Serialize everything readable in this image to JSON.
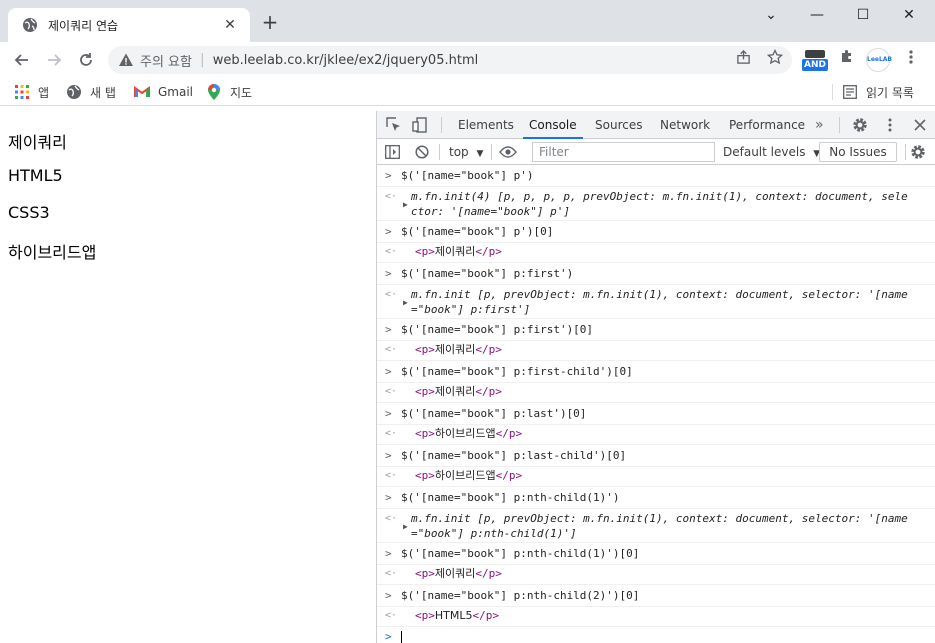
{
  "browser": {
    "tab_title": "제이쿼리 연습",
    "tab_close": "✕",
    "new_tab": "+",
    "window_controls": {
      "minimize": "⌄",
      "restore": "—",
      "maximize": "☐",
      "close": "✕"
    }
  },
  "address_bar": {
    "security_label": "주의 요함",
    "url": "web.leelab.co.kr/jklee/ex2/jquery05.html",
    "extension_badge": "AND",
    "profile_label": "LeeLAB"
  },
  "bookmarks": {
    "items": [
      {
        "label": "앱",
        "icon": "apps-grid-icon"
      },
      {
        "label": "새 탭",
        "icon": "globe-icon"
      },
      {
        "label": "Gmail",
        "icon": "gmail-icon"
      },
      {
        "label": "지도",
        "icon": "maps-icon"
      }
    ],
    "reading_list": "읽기 목록"
  },
  "page": {
    "paragraphs": [
      "제이쿼리",
      "HTML5",
      "CSS3",
      "하이브리드앱"
    ]
  },
  "devtools": {
    "tabs": [
      "Elements",
      "Console",
      "Sources",
      "Network",
      "Performance"
    ],
    "active_tab": "Console",
    "more_tabs": "»",
    "context": "top",
    "filter_placeholder": "Filter",
    "levels": "Default levels",
    "issues": "No Issues",
    "console": {
      "in1": "$('[name=\"book\"] p')",
      "out1_line1": "m.fn.init(4) [p, p, p, p, prevObject: m.fn.init(1), context: document, sele",
      "out1_line2": "ctor: '[name=\"book\"] p']",
      "in2": "$('[name=\"book\"] p')[0]",
      "out2": "제이쿼리",
      "in3": "$('[name=\"book\"] p:first')",
      "out3_line1": "m.fn.init [p, prevObject: m.fn.init(1), context: document, selector: '[name",
      "out3_line2": "=\"book\"] p:first']",
      "in4": "$('[name=\"book\"] p:first')[0]",
      "out4": "제이쿼리",
      "in5": "$('[name=\"book\"] p:first-child')[0]",
      "out5": "제이쿼리",
      "in6": "$('[name=\"book\"] p:last')[0]",
      "out6": "하이브리드앱",
      "in7": "$('[name=\"book\"] p:last-child')[0]",
      "out7": "하이브리드앱",
      "in8": "$('[name=\"book\"] p:nth-child(1)')",
      "out8_line1": "m.fn.init [p, prevObject: m.fn.init(1), context: document, selector: '[name",
      "out8_line2": "=\"book\"] p:nth-child(1)']",
      "in9": "$('[name=\"book\"] p:nth-child(1)')[0]",
      "out9": "제이쿼리",
      "in10": "$('[name=\"book\"] p:nth-child(2)')[0]",
      "out10": "HTML5",
      "tag_open": "<p>",
      "tag_close": "</p>"
    }
  },
  "colors": {
    "accent": "#1a73e8",
    "tab_strip": "#dee1e6",
    "omnibox": "#f1f3f4",
    "tag": "#881280"
  }
}
